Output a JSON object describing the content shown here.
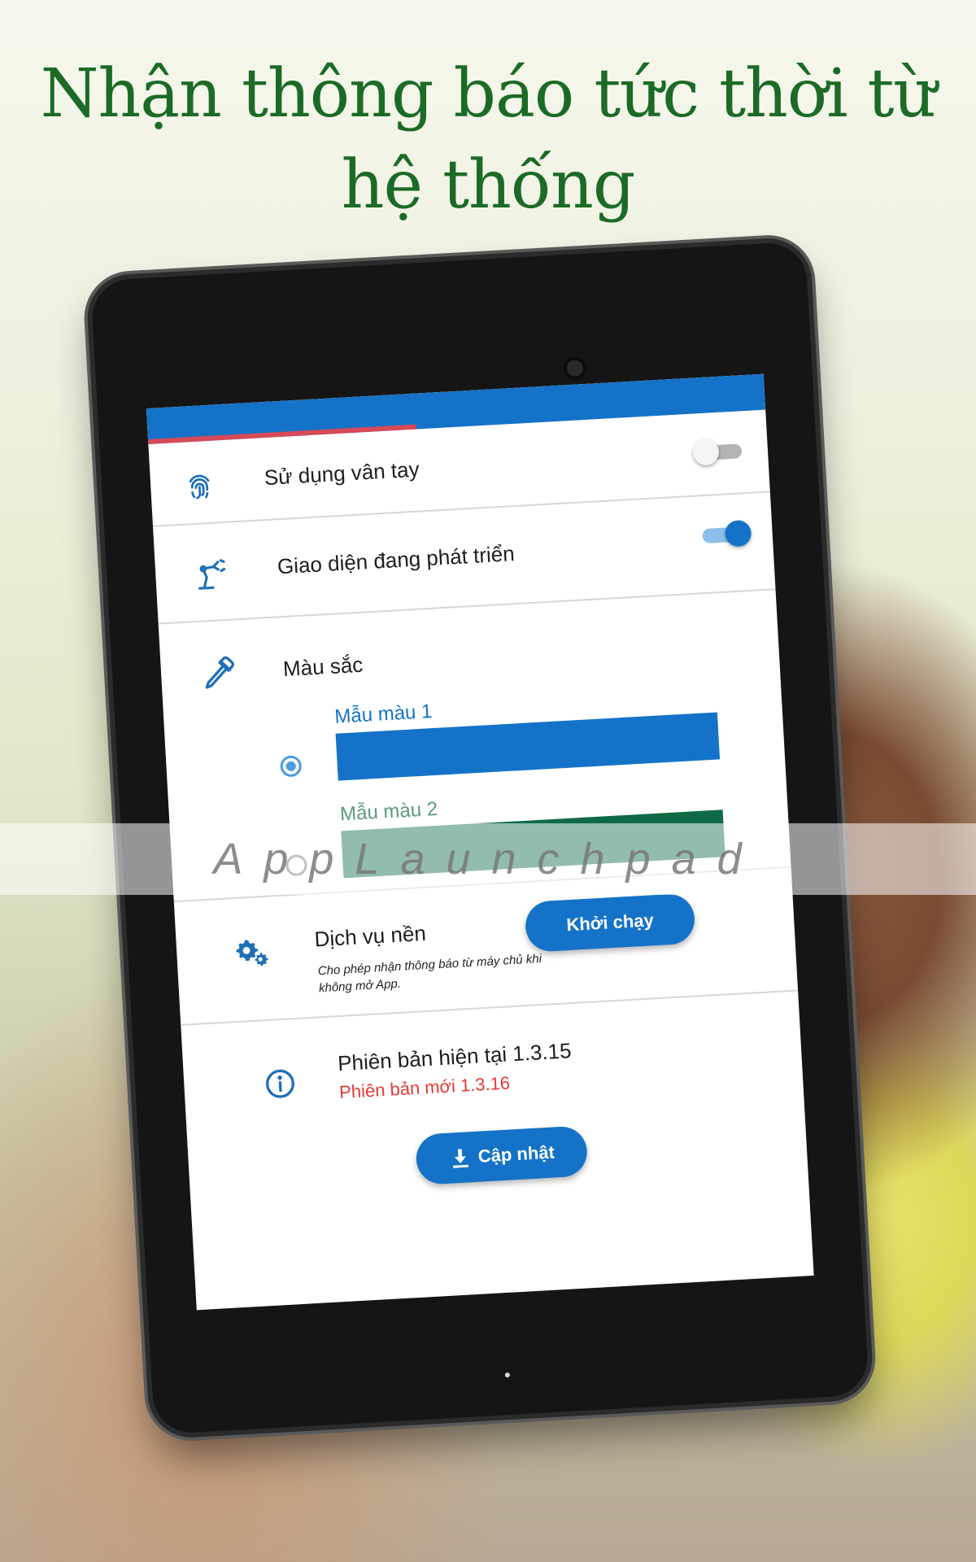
{
  "headline": {
    "line1": "Nhận thông báo tức thời từ",
    "line2": "hệ thống"
  },
  "settings": {
    "fingerprint": {
      "label": "Sử dụng vân tay",
      "toggle": "off",
      "icon": "fingerprint-icon"
    },
    "dev_ui": {
      "label": "Giao diện đang phát triển",
      "toggle": "on",
      "icon": "robot-arm-icon"
    },
    "colors": {
      "label": "Màu sắc",
      "icon": "eyedropper-icon",
      "options": [
        {
          "name": "Mẫu màu 1",
          "selected": true,
          "color": "#1473c8",
          "label_color": "#1473c8"
        },
        {
          "name": "Mẫu màu 2",
          "selected": false,
          "color": "#0f6b45",
          "label_color": "#5a9a7c"
        }
      ]
    },
    "background_service": {
      "label": "Dịch vụ nền",
      "description": "Cho phép nhận thông báo từ máy chủ khi không mở App.",
      "button": "Khởi chạy",
      "icon": "gears-icon"
    },
    "version": {
      "current": "Phiên bản hiện tại 1.3.15",
      "new": "Phiên bản mới 1.3.16",
      "update_button": "Cập nhật",
      "icon": "info-icon"
    }
  },
  "watermark": "AppLaunchpad",
  "colors": {
    "accent": "#1473c8",
    "headline": "#1b6b26",
    "alert": "#e53935",
    "progress": "#d84a57"
  }
}
